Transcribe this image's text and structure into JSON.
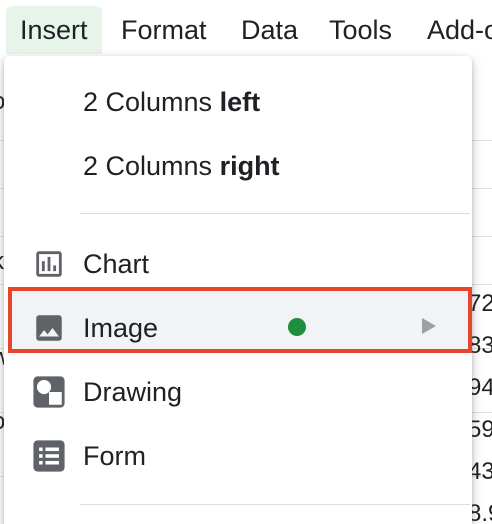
{
  "menubar": {
    "items": [
      {
        "label": "Insert"
      },
      {
        "label": "Format"
      },
      {
        "label": "Data"
      },
      {
        "label": "Tools"
      },
      {
        "label": "Add-o"
      }
    ]
  },
  "sheet": {
    "left_fragments": [
      "o",
      "k",
      "r",
      "w",
      "r",
      "o",
      "r"
    ],
    "right_values": [
      "72",
      "83",
      "94",
      "59",
      "43",
      "8.9"
    ]
  },
  "menu": {
    "columns_left": {
      "prefix": "2 Columns ",
      "bold": "left"
    },
    "columns_right": {
      "prefix": "2 Columns ",
      "bold": "right"
    },
    "chart": {
      "label": "Chart",
      "icon": "bar-chart-icon"
    },
    "image": {
      "label": "Image",
      "icon": "image-icon",
      "badge_color": "#1e8e3e"
    },
    "drawing": {
      "label": "Drawing",
      "icon": "drawing-icon"
    },
    "form": {
      "label": "Form",
      "icon": "form-icon"
    }
  },
  "colors": {
    "highlight_border": "#e8452c",
    "menubar_active": "#e6f4ea",
    "icon": "#5f6368"
  }
}
